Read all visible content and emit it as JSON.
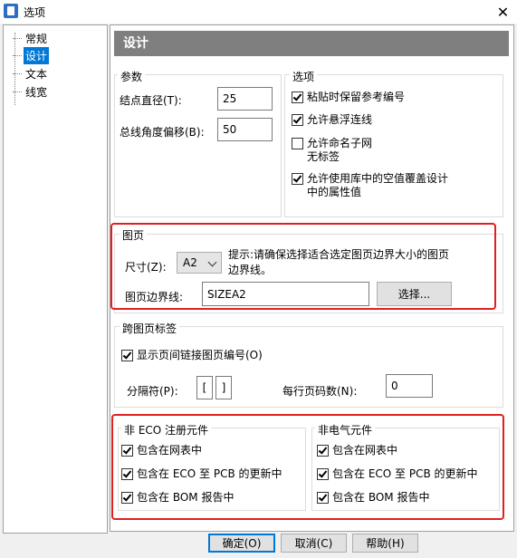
{
  "window": {
    "title": "选项",
    "close_glyph": "✕"
  },
  "tree": {
    "items": [
      {
        "label": "常规"
      },
      {
        "label": "设计"
      },
      {
        "label": "文本"
      },
      {
        "label": "线宽"
      }
    ],
    "selected": "设计"
  },
  "section_header": "设计",
  "params": {
    "title": "参数",
    "node_diameter_label": "结点直径(T):",
    "node_diameter_value": "25",
    "bus_angle_label": "总线角度偏移(B):",
    "bus_angle_value": "50"
  },
  "options": {
    "title": "选项",
    "keep_ref_on_paste": {
      "label": "粘贴时保留参考编号",
      "checked": true
    },
    "allow_floating": {
      "label": "允许悬浮连线",
      "checked": true
    },
    "allow_unnamed_net_1": {
      "label": "允许命名子网",
      "checked": false
    },
    "allow_unnamed_net_2": "无标签",
    "allow_lib_empty_1": {
      "label": "允许使用库中的空值覆盖设计",
      "checked": true
    },
    "allow_lib_empty_2": "中的属性值"
  },
  "sheet": {
    "title": "图页",
    "size_label": "尺寸(Z):",
    "size_value": "A2",
    "hint_line1": "提示:请确保选择适合选定图页边界大小的图页",
    "hint_line2": "边界线。",
    "border_label": "图页边界线:",
    "border_value": "SIZEA2",
    "select_button": "选择..."
  },
  "cross_sheet": {
    "title": "跨图页标签",
    "show_link_numbers": {
      "label": "显示页间链接图页编号(O)",
      "checked": true
    },
    "separator_label": "分隔符(P):",
    "sep_left": "[",
    "sep_right": "]",
    "per_line_label": "每行页码数(N):",
    "per_line_value": "0"
  },
  "non_eco": {
    "title": "非 ECO 注册元件",
    "netlist": {
      "label": "包含在网表中",
      "checked": true
    },
    "eco_pcb": {
      "label": "包含在 ECO 至 PCB 的更新中",
      "checked": true
    },
    "bom": {
      "label": "包含在 BOM 报告中",
      "checked": true
    }
  },
  "non_electrical": {
    "title": "非电气元件",
    "netlist": {
      "label": "包含在网表中",
      "checked": true
    },
    "eco_pcb": {
      "label": "包含在 ECO 至 PCB 的更新中",
      "checked": true
    },
    "bom": {
      "label": "包含在 BOM 报告中",
      "checked": true
    }
  },
  "buttons": {
    "ok": "确定(O)",
    "cancel": "取消(C)",
    "help": "帮助(H)"
  },
  "colors": {
    "highlight_border": "#e02020",
    "selection": "#0078d7",
    "header_band": "#7f7f7f"
  }
}
